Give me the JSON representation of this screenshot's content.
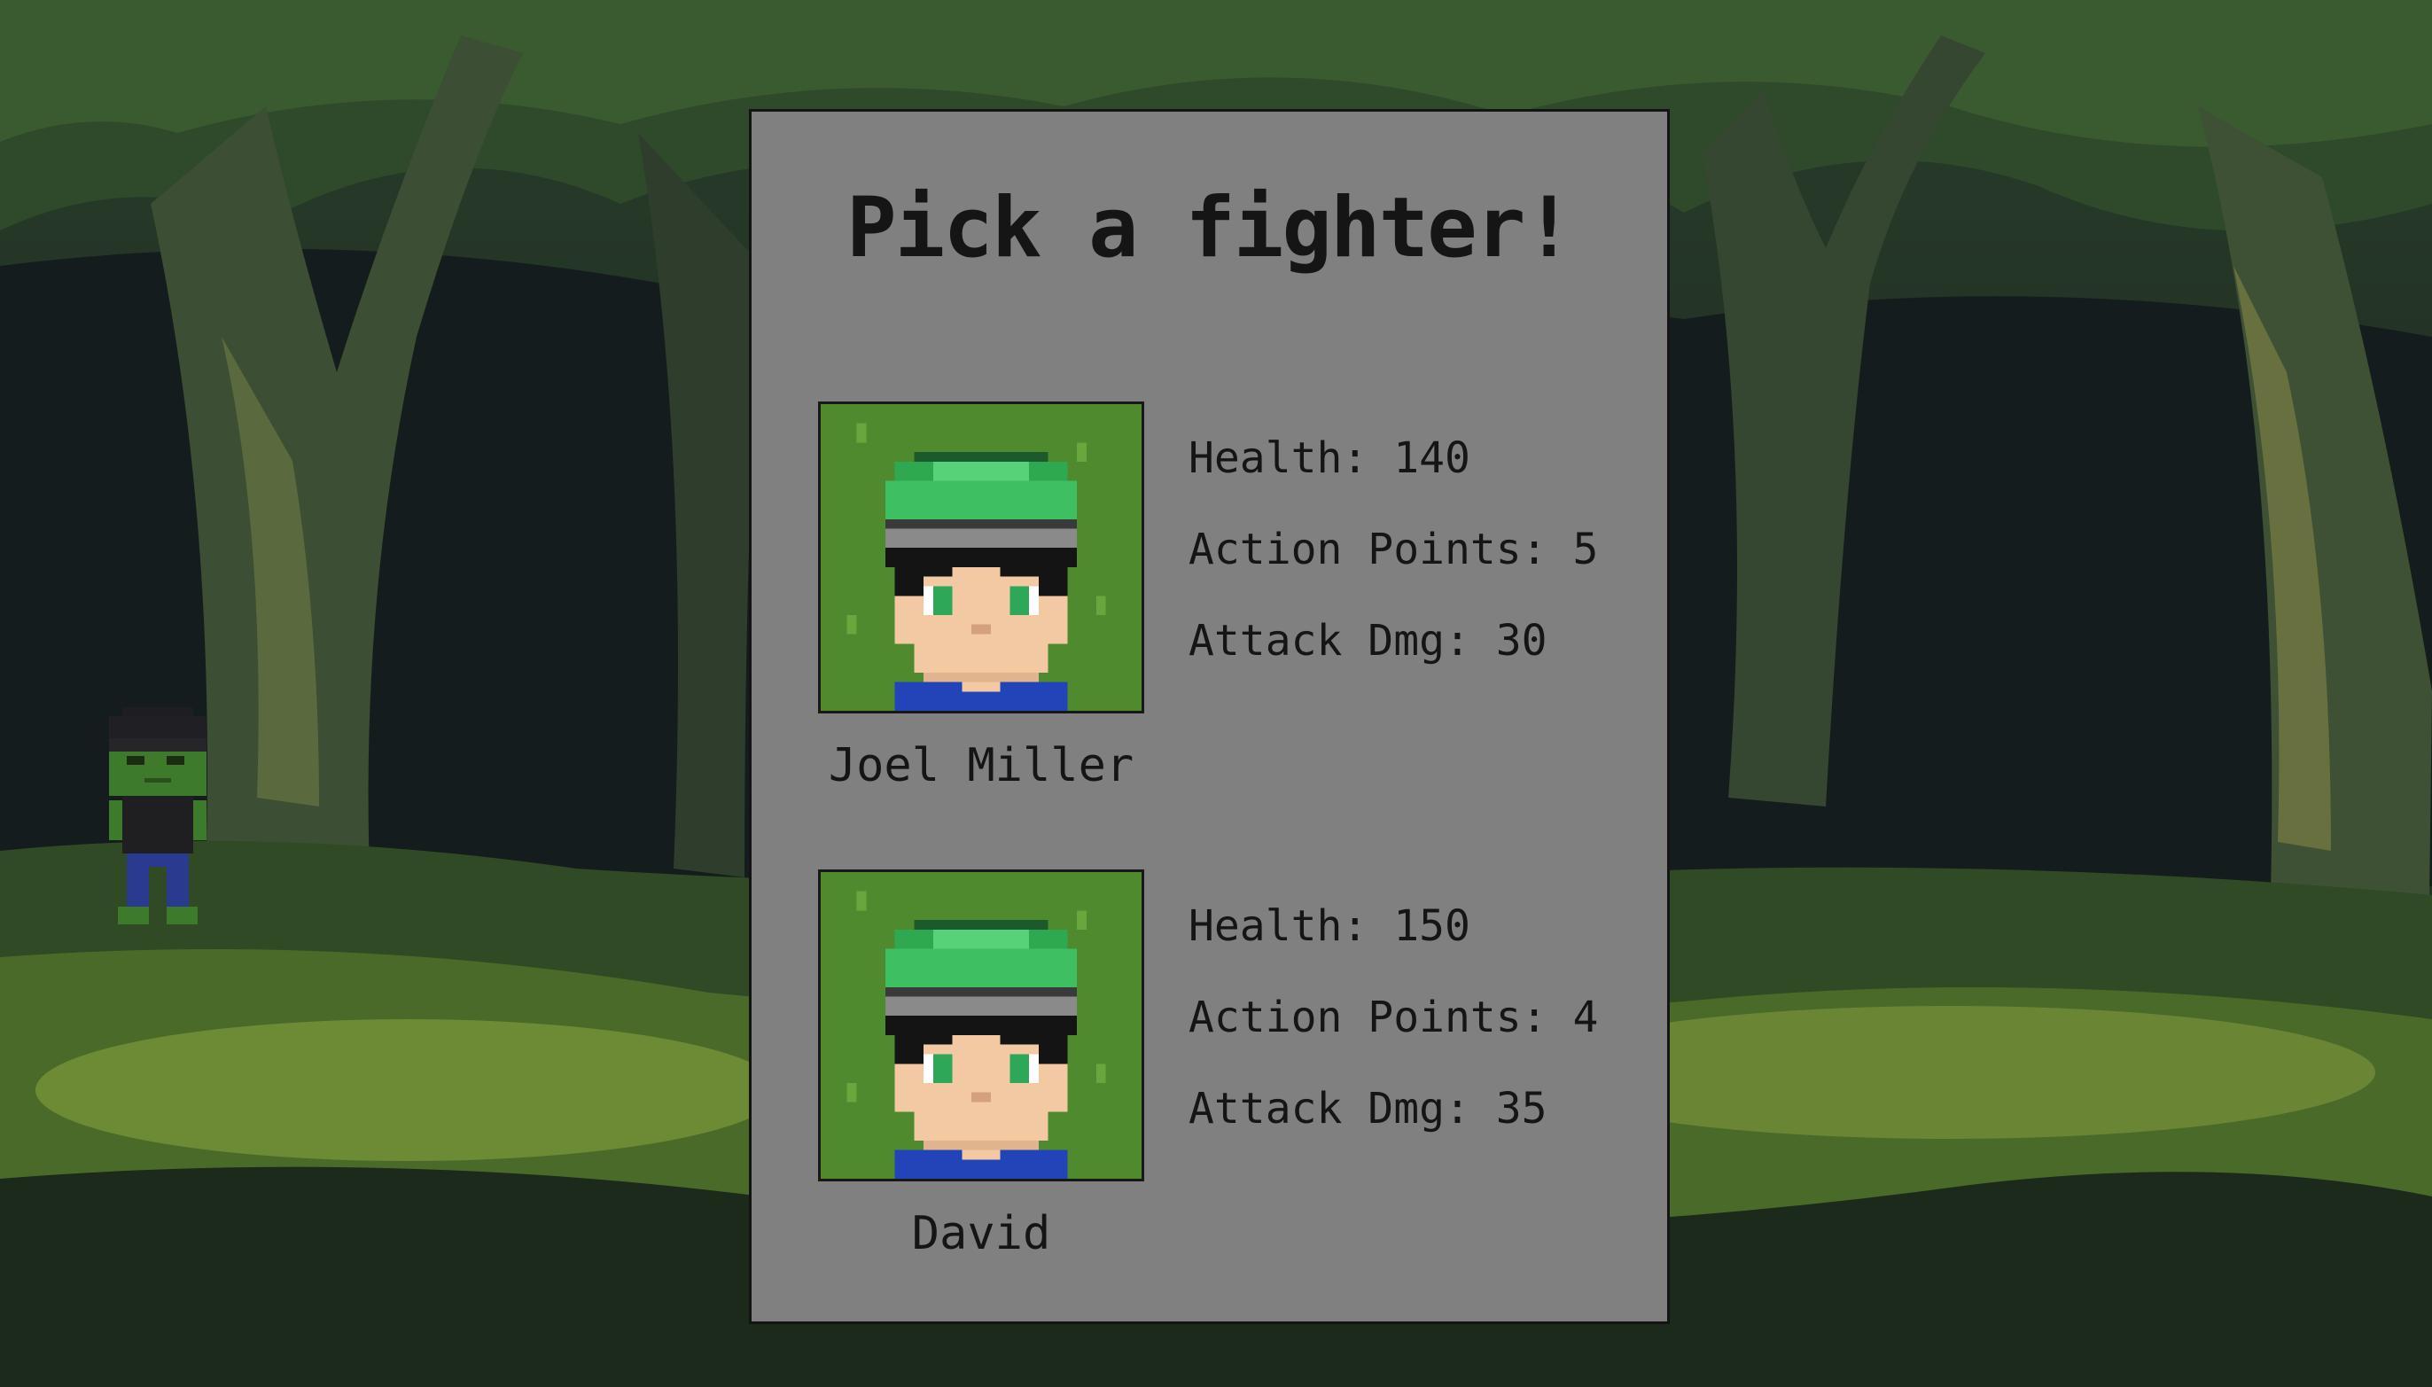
{
  "title": "Pick a fighter!",
  "fighters": [
    {
      "name": "Joel Miller",
      "health": "Health: 140",
      "action_points": "Action Points: 5",
      "attack": "Attack Dmg: 30"
    },
    {
      "name": "David",
      "health": "Health: 150",
      "action_points": "Action Points: 4",
      "attack": "Attack Dmg: 35"
    }
  ],
  "colors": {
    "panel": "#808080",
    "text": "#151515",
    "cap": "#3ec062",
    "portrait_bg": "#4f8a2e",
    "forest_dark": "#18241a"
  },
  "icons": {
    "player": "zombie-player-sprite",
    "portrait": "fighter-portrait"
  }
}
